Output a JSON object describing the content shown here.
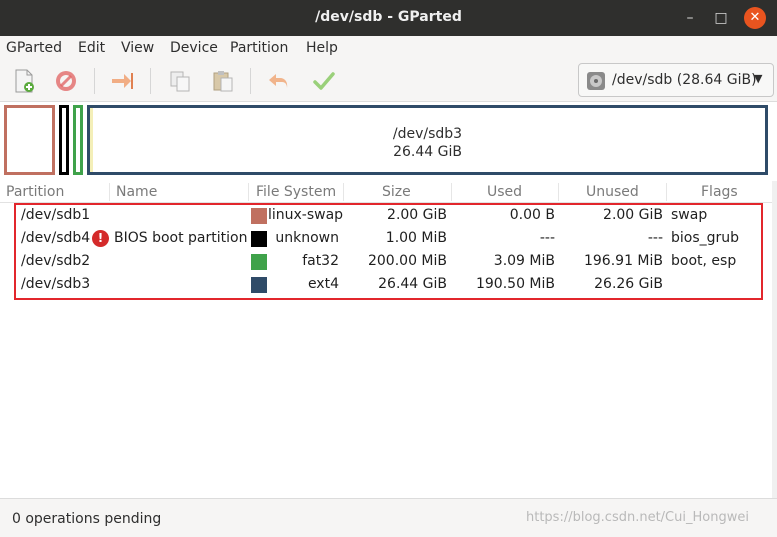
{
  "window": {
    "title": "/dev/sdb - GParted",
    "controls": {
      "minimize": "–",
      "maximize": "□",
      "close": "✕"
    }
  },
  "menubar": {
    "items": [
      "GParted",
      "Edit",
      "View",
      "Device",
      "Partition",
      "Help"
    ]
  },
  "toolbar": {
    "icons": [
      "new-partition-icon",
      "delete-icon",
      "resize-move-icon",
      "copy-icon",
      "paste-icon",
      "undo-icon",
      "apply-icon"
    ]
  },
  "device_selector": {
    "value": "/dev/sdb (28.64 GiB)",
    "icon": "disk-icon"
  },
  "graphic": {
    "selected_name": "/dev/sdb3",
    "selected_size": "26.44 GiB",
    "colors": {
      "swap": "#c07060",
      "bios": "#000000",
      "fat32": "#3fa24a",
      "ext4": "#2f4b68"
    }
  },
  "table": {
    "headers": [
      "Partition",
      "Name",
      "File System",
      "Size",
      "Used",
      "Unused",
      "Flags"
    ],
    "rows": [
      {
        "partition": "/dev/sdb1",
        "name": "",
        "fs": "linux-swap",
        "color": "#c07060",
        "size": "2.00 GiB",
        "used": "0.00 B",
        "unused": "2.00 GiB",
        "flags": "swap",
        "warning": false
      },
      {
        "partition": "/dev/sdb4",
        "name": "BIOS boot partition",
        "fs": "unknown",
        "color": "#000000",
        "size": "1.00 MiB",
        "used": "---",
        "unused": "---",
        "flags": "bios_grub",
        "warning": true,
        "warning_glyph": "!"
      },
      {
        "partition": "/dev/sdb2",
        "name": "",
        "fs": "fat32",
        "color": "#3fa24a",
        "size": "200.00 MiB",
        "used": "3.09 MiB",
        "unused": "196.91 MiB",
        "flags": "boot, esp",
        "warning": false
      },
      {
        "partition": "/dev/sdb3",
        "name": "",
        "fs": "ext4",
        "color": "#2f4b68",
        "size": "26.44 GiB",
        "used": "190.50 MiB",
        "unused": "26.26 GiB",
        "flags": "",
        "warning": false
      }
    ]
  },
  "status": {
    "text": "0 operations pending",
    "watermark": "https://blog.csdn.net/Cui_Hongwei"
  },
  "accent_colors": {
    "highlight": "#e2262c",
    "close_button": "#e9541f"
  }
}
